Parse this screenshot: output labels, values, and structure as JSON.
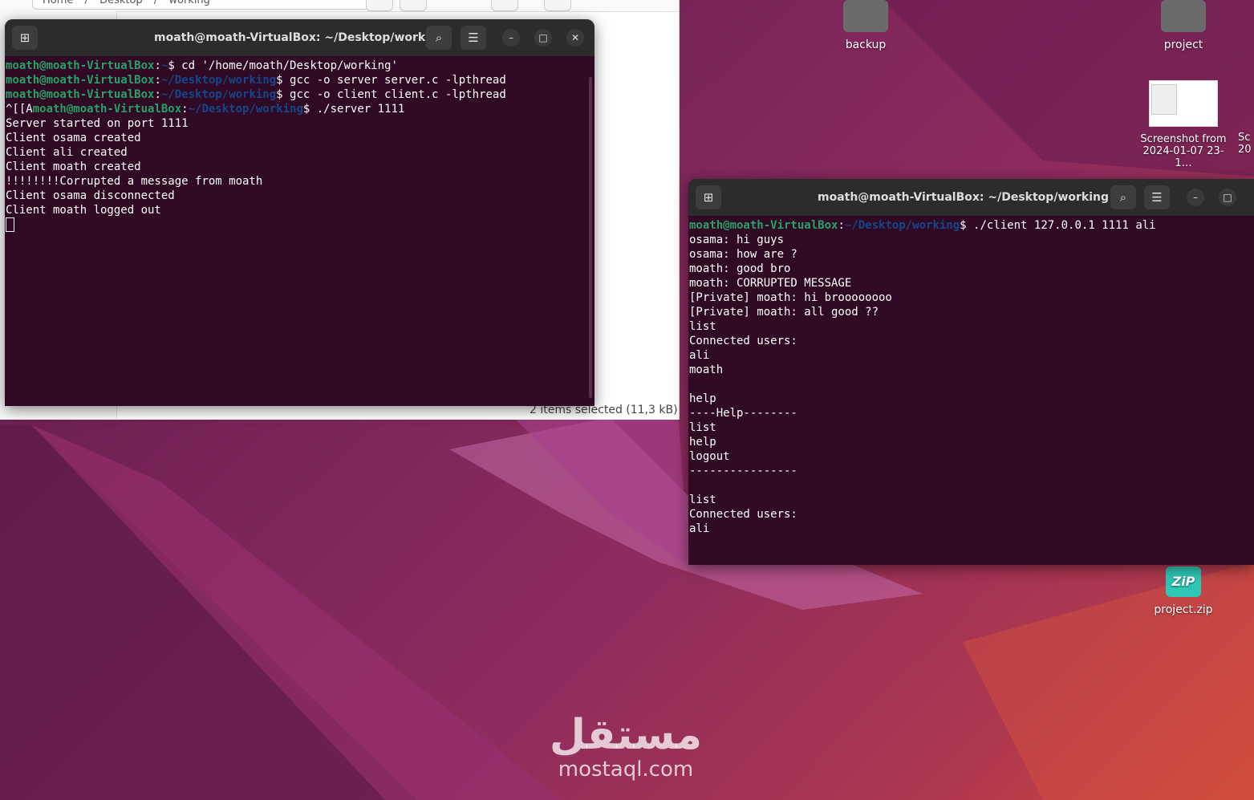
{
  "file_manager": {
    "breadcrumb": [
      "Home",
      "/",
      "Desktop",
      "/",
      "working"
    ],
    "status": "2 items selected  (11,3 kB)"
  },
  "desktop": {
    "icons": [
      {
        "label": "backup",
        "icon": "folder-icon"
      },
      {
        "label": "project",
        "icon": "folder-icon"
      },
      {
        "label_line1": "Screenshot from",
        "label_line2": "2024-01-07 23-1…",
        "icon": "image-thumbnail-icon"
      },
      {
        "label_line1": "Sc",
        "label_line2": "20"
      },
      {
        "label": "project.zip",
        "icon": "zip-archive-icon",
        "badge": "ZiP"
      }
    ]
  },
  "server_terminal": {
    "title": "moath@moath-VirtualBox: ~/Desktop/working",
    "prompt_user": "moath@moath-VirtualBox",
    "lines": [
      {
        "pre": "",
        "user": "moath@moath-VirtualBox",
        "sep": ":",
        "path": "~",
        "cmd": "$ cd '/home/moath/Desktop/working'"
      },
      {
        "pre": "",
        "user": "moath@moath-VirtualBox",
        "sep": ":",
        "path": "~/Desktop/working",
        "cmd": "$ gcc -o server server.c -lpthread"
      },
      {
        "pre": "",
        "user": "moath@moath-VirtualBox",
        "sep": ":",
        "path": "~/Desktop/working",
        "cmd": "$ gcc -o client client.c -lpthread"
      },
      {
        "pre": "^[[A",
        "user": "moath@moath-VirtualBox",
        "sep": ":",
        "path": "~/Desktop/working",
        "cmd": "$ ./server 1111"
      }
    ],
    "output": [
      "Server started on port 1111",
      "Client osama created",
      "Client ali created",
      "Client moath created",
      "!!!!!!!!Corrupted a message from moath",
      "Client osama disconnected",
      "Client moath logged out"
    ]
  },
  "client_terminal": {
    "title": "moath@moath-VirtualBox: ~/Desktop/working",
    "prompt": {
      "user": "moath@moath-VirtualBox",
      "sep": ":",
      "path": "~/Desktop/working",
      "cmd": "$ ./client 127.0.0.1 1111 ali"
    },
    "output": [
      "osama: hi guys",
      "osama: how are ?",
      "moath: good bro",
      "moath: CORRUPTED MESSAGE",
      "[Private] moath: hi broooooooo",
      "[Private] moath: all good ??",
      "list",
      "Connected users:",
      "ali",
      "moath",
      "",
      "help",
      "----Help--------",
      "list",
      "help",
      "logout",
      "----------------",
      "",
      "list",
      "Connected users:",
      "ali"
    ]
  },
  "watermark": {
    "arabic": "مستقل",
    "latin": "mostaql.com"
  },
  "colors": {
    "terminal_bg": "#300a24",
    "header_bg": "#2c2c2c",
    "prompt_user": "#26a269",
    "prompt_path": "#12488b"
  }
}
